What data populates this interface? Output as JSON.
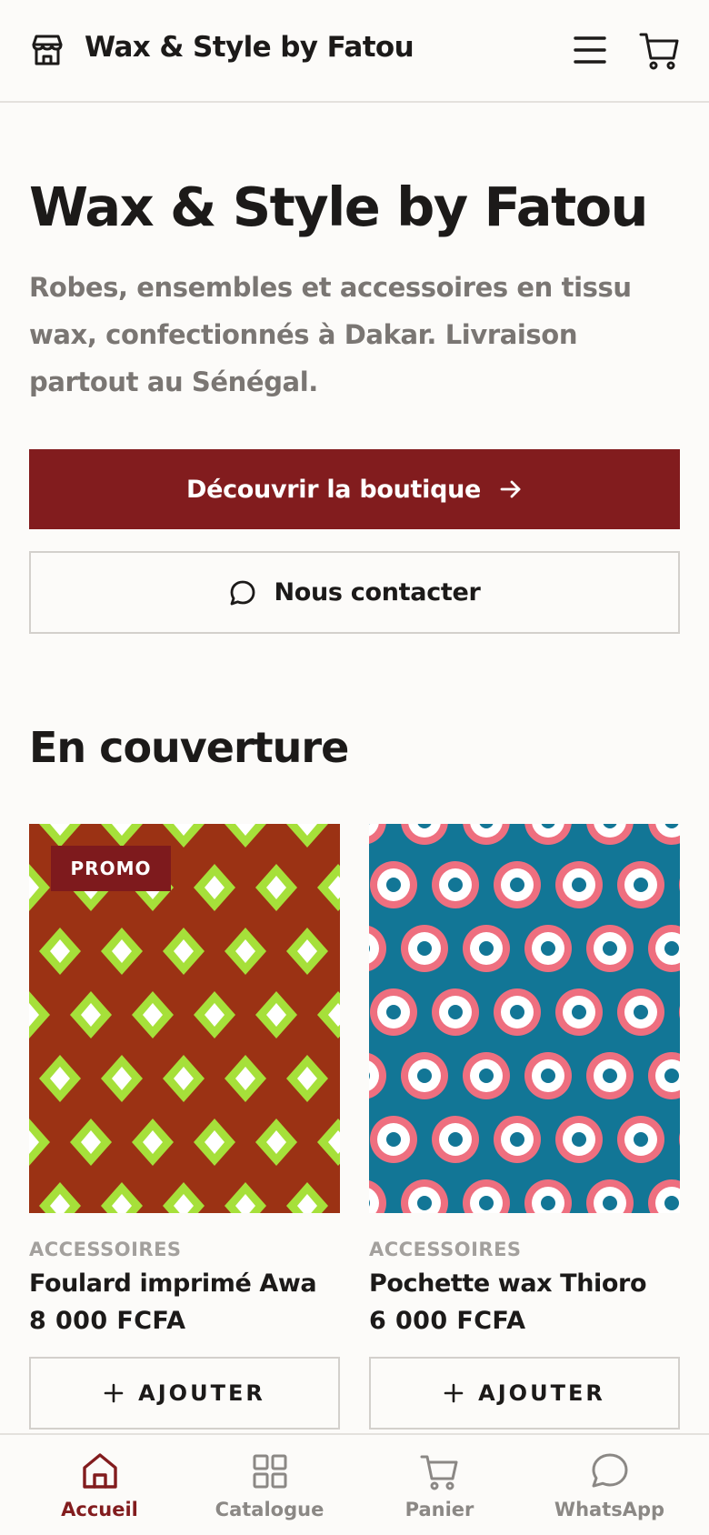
{
  "header": {
    "brand": "Wax & Style by Fatou"
  },
  "hero": {
    "title": "Wax & Style by Fatou",
    "subtitle": "Robes, ensembles et accessoires en tissu wax, confectionnés à Dakar. Livraison partout au Sénégal.",
    "primary_cta": "Découvrir la boutique",
    "secondary_cta": "Nous contacter"
  },
  "featured": {
    "title": "En couverture",
    "products": [
      {
        "badge": "PROMO",
        "category": "ACCESSOIRES",
        "name": "Foulard imprimé Awa",
        "price": "8 000 FCFA",
        "add_label": "AJOUTER",
        "pattern": "diamonds",
        "bg_color": "#9b3214",
        "accent_color": "#a6e03a"
      },
      {
        "badge": "",
        "category": "ACCESSOIRES",
        "name": "Pochette wax Thioro",
        "price": "6 000 FCFA",
        "add_label": "AJOUTER",
        "pattern": "rings",
        "bg_color": "#127696",
        "accent_color": "#ee6f7f"
      }
    ]
  },
  "tabbar": {
    "items": [
      {
        "label": "Accueil",
        "icon": "home-icon",
        "active": true
      },
      {
        "label": "Catalogue",
        "icon": "grid-icon",
        "active": false
      },
      {
        "label": "Panier",
        "icon": "cart-icon",
        "active": false
      },
      {
        "label": "WhatsApp",
        "icon": "chat-icon",
        "active": false
      }
    ]
  },
  "colors": {
    "brand": "#821c1e",
    "background": "#fcfbf9",
    "text": "#1c1a19",
    "muted": "#7a7673"
  }
}
